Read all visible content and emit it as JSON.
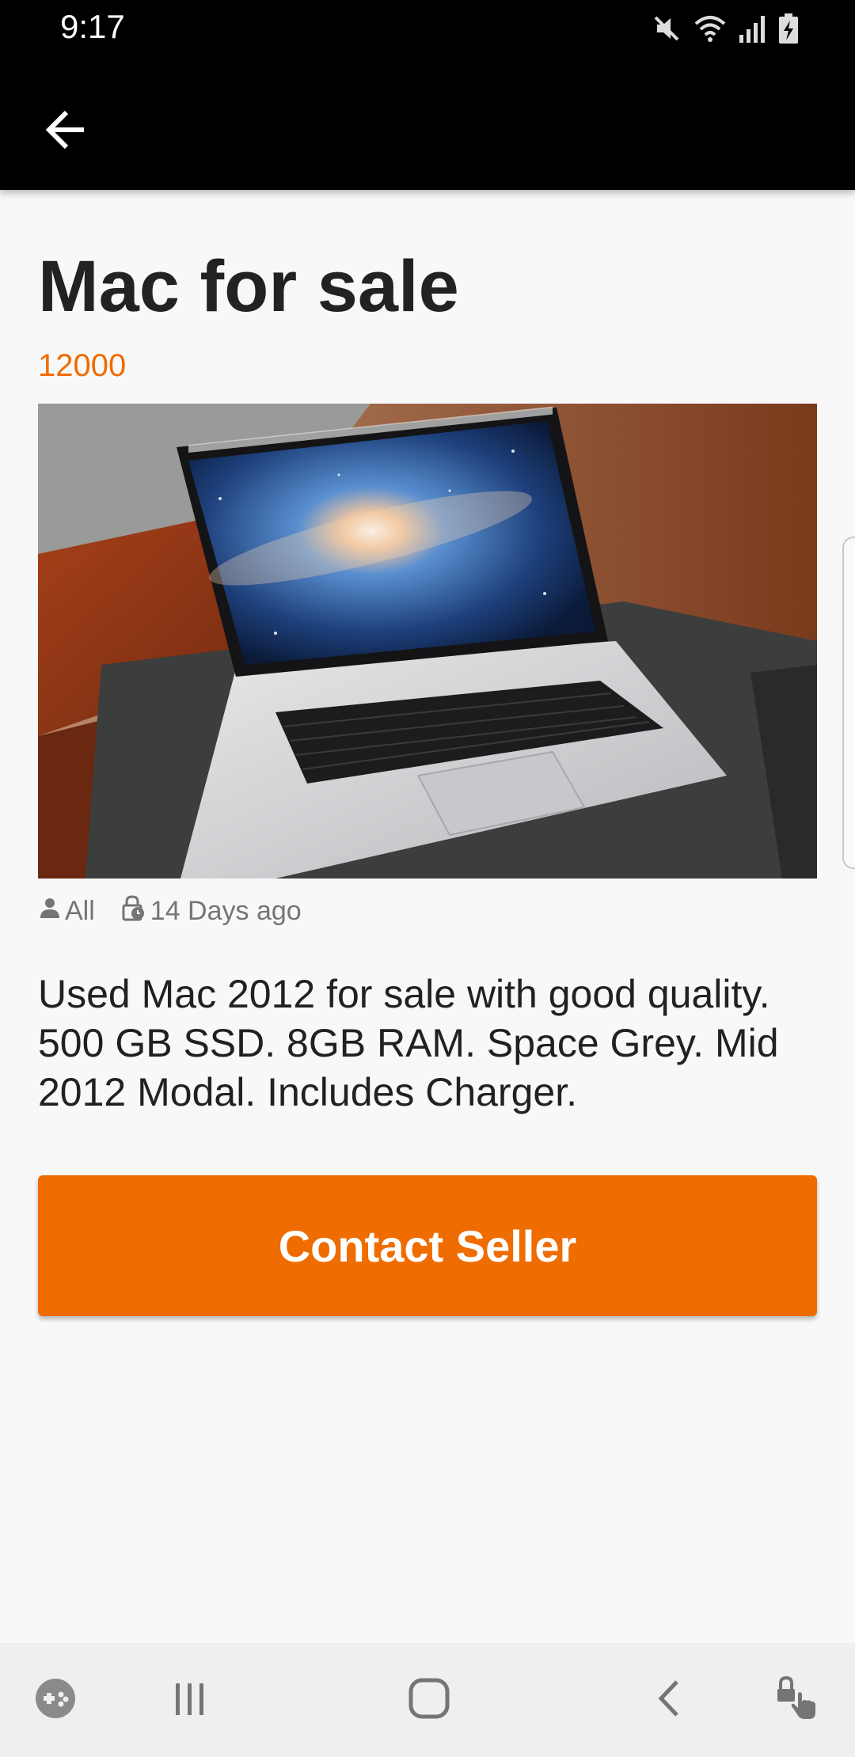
{
  "status_bar": {
    "time": "9:17",
    "icons": [
      "mute-icon",
      "wifi-icon",
      "signal-icon",
      "battery-charging-icon"
    ]
  },
  "app_bar": {
    "back_icon": "arrow-left-icon"
  },
  "listing": {
    "title": "Mac for sale",
    "price": "12000",
    "image_subject": "laptop-photo",
    "audience": "All",
    "posted": "14 Days ago",
    "description": "Used Mac 2012 for sale with good quality. 500 GB SSD. 8GB RAM. Space Grey. Mid 2012 Modal. Includes Charger.",
    "contact_label": "Contact Seller"
  },
  "colors": {
    "accent": "#ef6c00",
    "app_bar": "#000000",
    "background": "#f8f8f8",
    "text": "#212121",
    "meta_text": "#757575"
  },
  "nav_bar": {
    "buttons": [
      "game-launcher-icon",
      "recent-apps-icon",
      "home-icon",
      "back-icon",
      "touch-lock-icon"
    ]
  }
}
